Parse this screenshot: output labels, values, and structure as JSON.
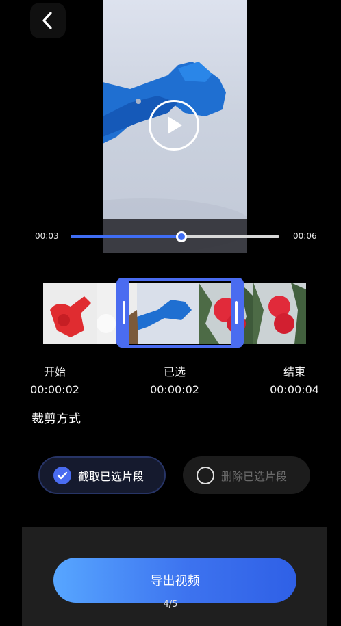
{
  "nav": {
    "back_icon": "chevron-left-icon"
  },
  "player": {
    "play_icon": "play-icon",
    "current_time": "00:03",
    "end_time": "00:06",
    "progress": 0.53
  },
  "trim": {
    "start_label": "开始",
    "start_value": "00:00:02",
    "selected_label": "已选",
    "selected_value": "00:00:02",
    "end_label": "结束",
    "end_value": "00:00:04"
  },
  "cut_mode": {
    "title": "裁剪方式",
    "options": [
      {
        "label": "截取已选片段",
        "selected": true
      },
      {
        "label": "删除已选片段",
        "selected": false
      }
    ]
  },
  "export": {
    "label": "导出视频"
  },
  "page_indicator": "4/5",
  "colors": {
    "accent": "#4a6cf0",
    "background": "#000000"
  }
}
